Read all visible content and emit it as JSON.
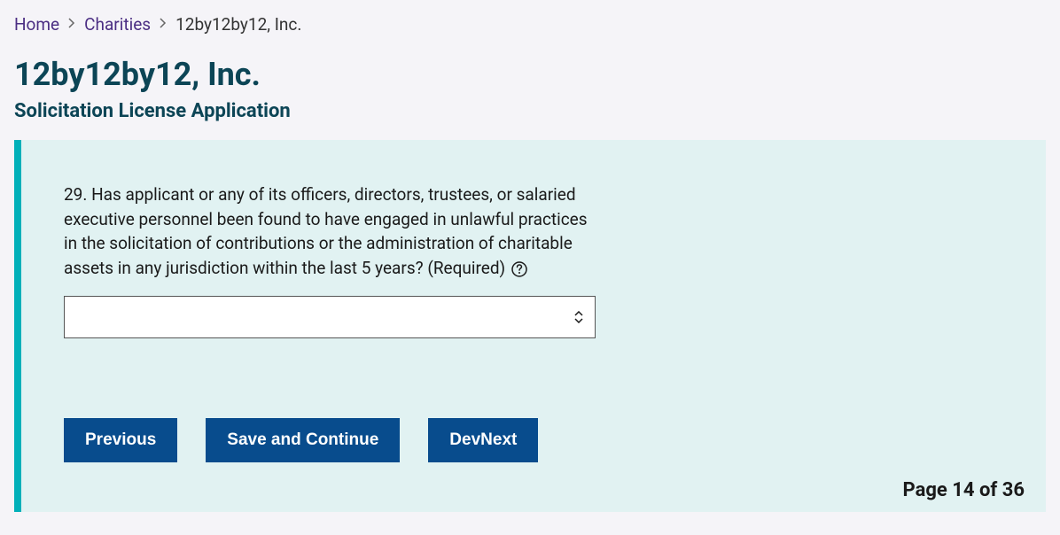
{
  "breadcrumb": {
    "home": "Home",
    "charities": "Charities",
    "current": "12by12by12, Inc."
  },
  "header": {
    "title": "12by12by12, Inc.",
    "subtitle": "Solicitation License Application"
  },
  "question": {
    "text": "29. Has applicant or any of its officers, directors, trustees, or salaried executive personnel been found to have engaged in unlawful practices in the solicitation of contributions or the administration of charitable assets in any jurisdiction within the last 5 years? (Required)",
    "value": ""
  },
  "buttons": {
    "previous": "Previous",
    "save": "Save and Continue",
    "devnext": "DevNext"
  },
  "pager": {
    "text": "Page 14 of 36"
  }
}
